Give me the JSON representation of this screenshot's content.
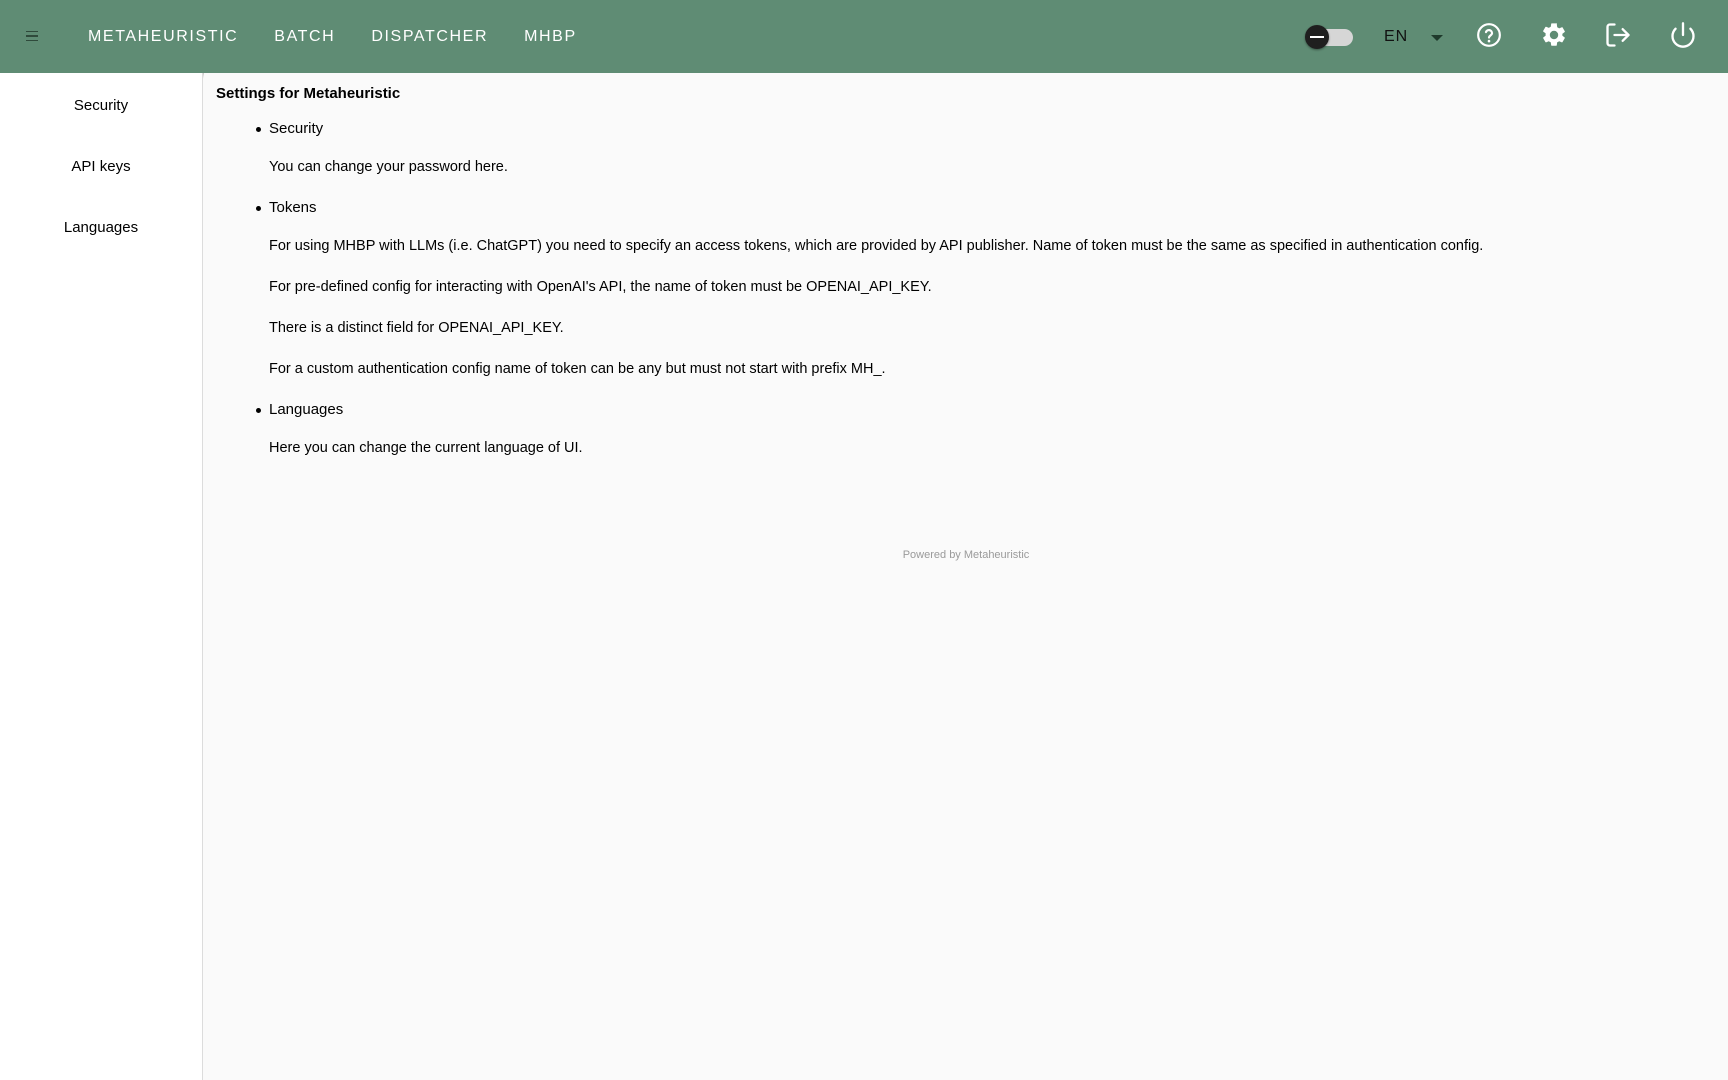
{
  "toolbar": {
    "nav": [
      {
        "label": "Metaheuristic"
      },
      {
        "label": "Batch"
      },
      {
        "label": "Dispatcher"
      },
      {
        "label": "MHBP"
      }
    ],
    "language": "EN",
    "colors": {
      "bar": "#5f8c74"
    }
  },
  "sidebar": {
    "items": [
      {
        "label": "Security"
      },
      {
        "label": "API keys"
      },
      {
        "label": "Languages"
      }
    ]
  },
  "main": {
    "title": "Settings for Metaheuristic",
    "sections": [
      {
        "heading": "Security",
        "paragraphs": [
          "You can change your password here."
        ]
      },
      {
        "heading": "Tokens",
        "paragraphs": [
          "For using MHBP with LLMs (i.e. ChatGPT) you need to specify an access tokens, which are provided by API publisher. Name of token must be the same as specified in authentication config.",
          "For pre-defined config for interacting with OpenAI's API, the name of token must be OPENAI_API_KEY.",
          "There is a distinct field for OPENAI_API_KEY.",
          "For a custom authentication config name of token can be any but must not start with prefix MH_."
        ]
      },
      {
        "heading": "Languages",
        "paragraphs": [
          "Here you can change the current language of UI."
        ]
      }
    ],
    "footer": "Powered by Metaheuristic"
  },
  "icons": {
    "menu": "menu-icon",
    "help": "help-circle-icon",
    "settings": "gear-icon",
    "logout": "logout-icon",
    "power": "power-icon"
  }
}
